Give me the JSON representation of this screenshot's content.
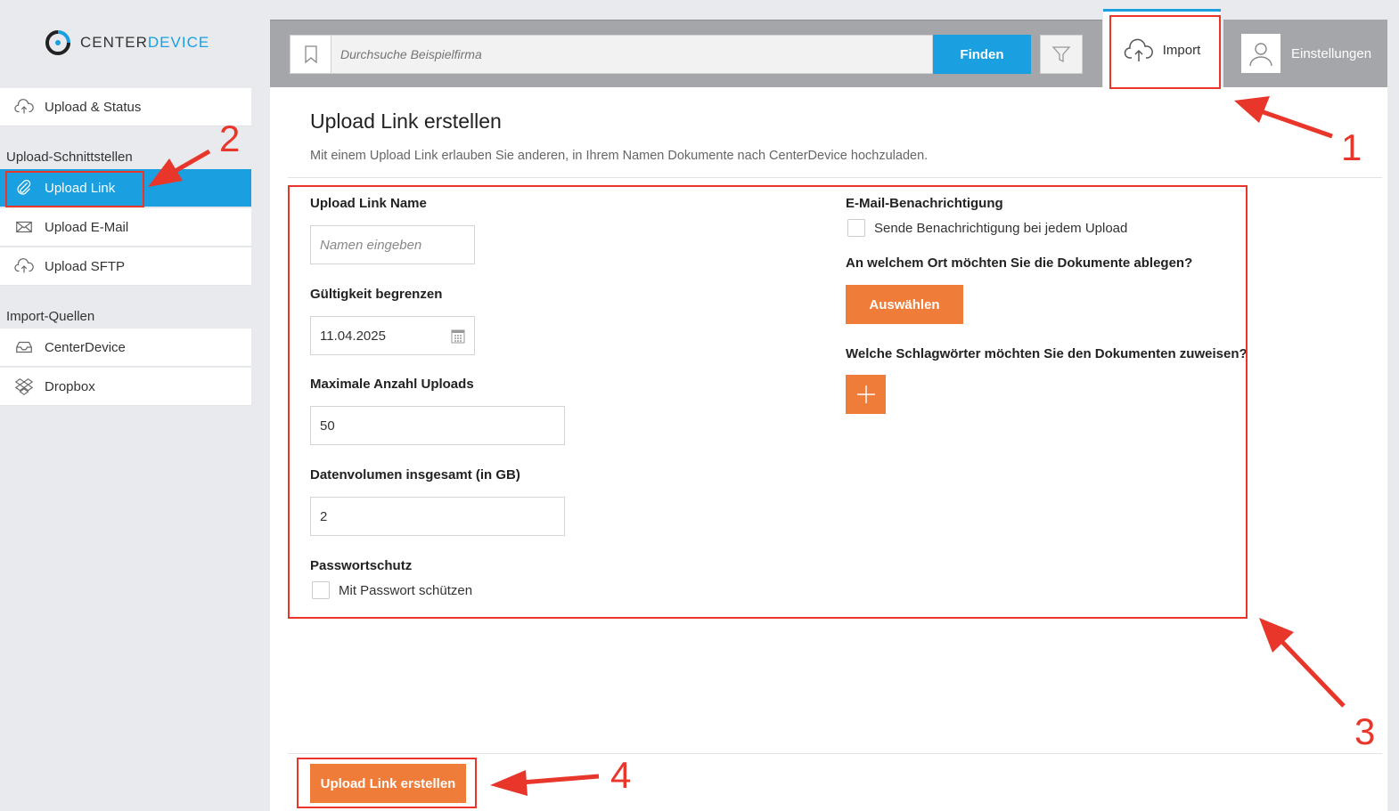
{
  "logo": {
    "part1": "CENTER",
    "part2": "DEVICE"
  },
  "sidebar": {
    "items": [
      {
        "label": "Upload & Status",
        "icon": "cloud-upload-icon"
      },
      {
        "label": "Upload Link",
        "icon": "paperclip-icon"
      },
      {
        "label": "Upload E-Mail",
        "icon": "envelope-icon"
      },
      {
        "label": "Upload SFTP",
        "icon": "cloud-upload-icon"
      },
      {
        "label": "CenterDevice",
        "icon": "inbox-icon"
      },
      {
        "label": "Dropbox",
        "icon": "dropbox-icon"
      }
    ],
    "sections": {
      "upload_interfaces": "Upload-Schnittstellen",
      "import_sources": "Import-Quellen"
    }
  },
  "header": {
    "search_placeholder": "Durchsuche Beispielfirma",
    "find_label": "Finden",
    "import_label": "Import",
    "settings_label": "Einstellungen"
  },
  "main": {
    "title": "Upload Link erstellen",
    "description": "Mit einem Upload Link erlauben Sie anderen, in Ihrem Namen Dokumente nach CenterDevice hochzuladen.",
    "form": {
      "name_label": "Upload Link Name",
      "name_placeholder": "Namen eingeben",
      "validity_label": "Gültigkeit begrenzen",
      "validity_value": "11.04.2025",
      "max_uploads_label": "Maximale Anzahl Uploads",
      "max_uploads_value": "50",
      "volume_label": "Datenvolumen insgesamt (in GB)",
      "volume_value": "2",
      "password_label": "Passwortschutz",
      "password_checkbox": "Mit Passwort schützen",
      "email_label": "E-Mail-Benachrichtigung",
      "email_checkbox": "Sende Benachrichtigung bei jedem Upload",
      "location_label": "An welchem Ort möchten Sie die Dokumente ablegen?",
      "select_button": "Auswählen",
      "tags_label": "Welche Schlagwörter möchten Sie den Dokumenten zuweisen?"
    },
    "submit_label": "Upload Link erstellen"
  },
  "annotations": {
    "n1": "1",
    "n2": "2",
    "n3": "3",
    "n4": "4",
    "color": "#e8362a"
  },
  "colors": {
    "accent_blue": "#1a9fe0",
    "accent_orange": "#f07c3a"
  }
}
